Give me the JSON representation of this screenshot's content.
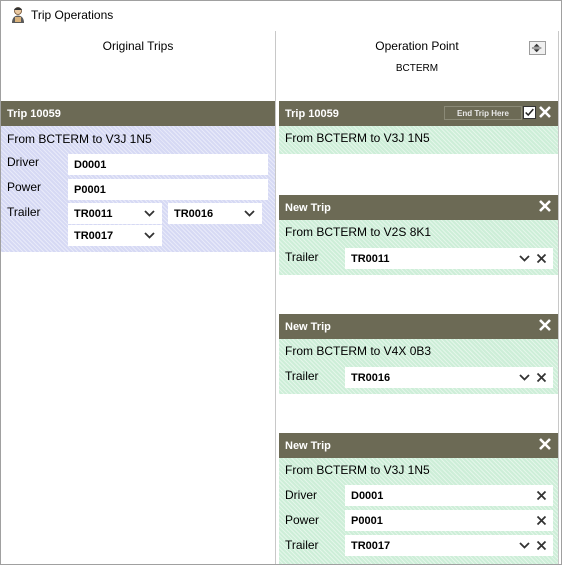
{
  "window": {
    "title": "Trip Operations"
  },
  "columns": {
    "original_title": "Original Trips",
    "operation_title": "Operation Point",
    "operation_value": "BCTERM"
  },
  "original_trip": {
    "header": "Trip 10059",
    "route": "From BCTERM to V3J 1N5",
    "driver_label": "Driver",
    "driver_value": "D0001",
    "power_label": "Power",
    "power_value": "P0001",
    "trailer_label": "Trailer",
    "trailers": [
      "TR0011",
      "TR0016",
      "TR0017"
    ]
  },
  "operation_trip": {
    "header": "Trip 10059",
    "end_trip_label": "End Trip Here",
    "route": "From BCTERM to V3J 1N5"
  },
  "new_trips": [
    {
      "header": "New Trip",
      "route": "From BCTERM to V2S 8K1",
      "trailer_label": "Trailer",
      "trailer_value": "TR0011"
    },
    {
      "header": "New Trip",
      "route": "From BCTERM to V4X 0B3",
      "trailer_label": "Trailer",
      "trailer_value": "TR0016"
    },
    {
      "header": "New Trip",
      "route": "From BCTERM to V3J 1N5",
      "driver_label": "Driver",
      "driver_value": "D0001",
      "power_label": "Power",
      "power_value": "P0001",
      "trailer_label": "Trailer",
      "trailer_value": "TR0017"
    }
  ],
  "colors": {
    "header_bg": "#6c6a55",
    "original_fill": "#d6d9f4",
    "new_fill": "#cdeed8"
  }
}
